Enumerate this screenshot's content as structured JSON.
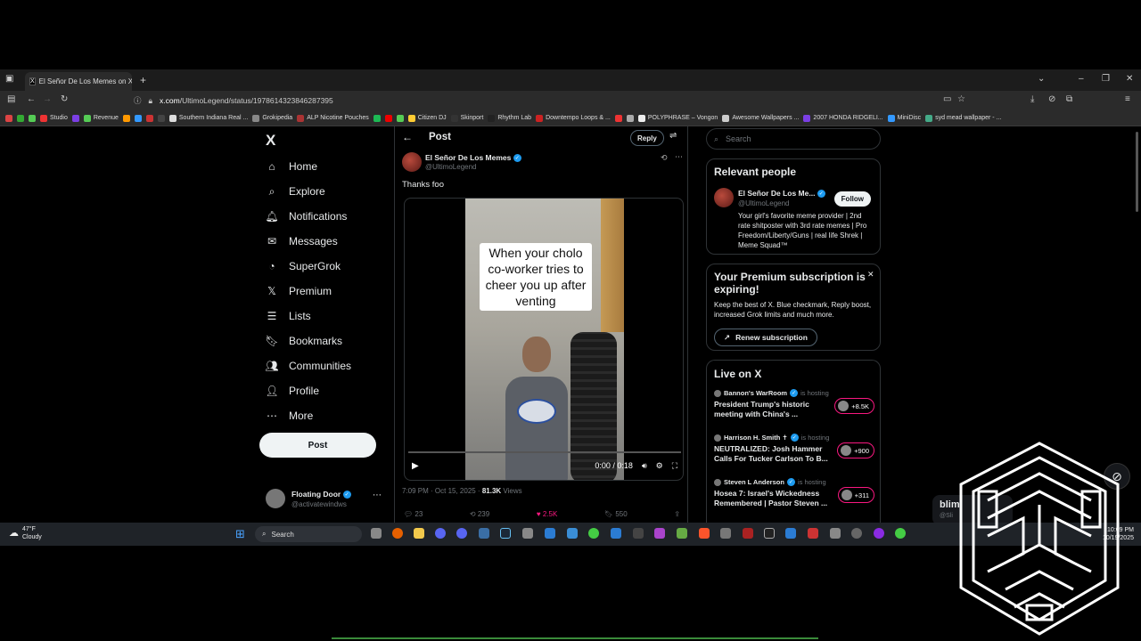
{
  "browser": {
    "tab_title": "El Señor De Los Memes on X: \"Thanks foo\"",
    "url_domain": "x.com",
    "url_path": "/UltimoLegend/status/1978614323846287395",
    "bookmarks": [
      "Studio",
      "Revenue",
      "Southern Indiana Real ...",
      "Grokipedia",
      "ALP Nicotine Pouches",
      "Citizen DJ",
      "Skinport",
      "Rhythm Lab",
      "Downtempo Loops & ...",
      "POLYPHRASE – Vongon",
      "Awesome Wallpapers ...",
      "2007 HONDA RIDGELI...",
      "MiniDisc",
      "syd mead wallpaper - ..."
    ]
  },
  "nav": {
    "logo": "X",
    "items": [
      {
        "label": "Home",
        "icon": "home-icon"
      },
      {
        "label": "Explore",
        "icon": "search-icon"
      },
      {
        "label": "Notifications",
        "icon": "bell-icon"
      },
      {
        "label": "Messages",
        "icon": "mail-icon"
      },
      {
        "label": "SuperGrok",
        "icon": "grok-icon"
      },
      {
        "label": "Premium",
        "icon": "x-premium-icon"
      },
      {
        "label": "Lists",
        "icon": "list-icon"
      },
      {
        "label": "Bookmarks",
        "icon": "bookmark-icon"
      },
      {
        "label": "Communities",
        "icon": "people-icon"
      },
      {
        "label": "Profile",
        "icon": "person-icon"
      },
      {
        "label": "More",
        "icon": "more-circle-icon"
      }
    ],
    "post_label": "Post",
    "account_name": "Floating Door",
    "account_handle": "@activatewindws"
  },
  "post": {
    "header": "Post",
    "reply_label": "Reply",
    "author_name": "El Señor De Los Memes",
    "author_handle": "@UltimoLegend",
    "text": "Thanks foo",
    "video_caption": "When your cholo co-worker tries to cheer you up after venting",
    "video_time": "0:00 / 0:18",
    "video_progress": 0,
    "timestamp": "7:09 PM · Oct 15, 2025 · ",
    "views_count": "81.3K",
    "views_label": " Views",
    "replies": "23",
    "reposts": "239",
    "likes": "2.5K",
    "bookmarks": "550"
  },
  "sidebar": {
    "search_placeholder": "Search",
    "relevant_title": "Relevant people",
    "person_name": "El Señor De Los Me...",
    "person_handle": "@UltimoLegend",
    "person_bio": "Your girl's favorite meme provider | 2nd rate shitposter with 3rd rate memes | Pro Freedom/Liberty/Guns | real life Shrek | Meme Squad™",
    "follow_label": "Follow",
    "premium_title": "Your Premium subscription is expiring!",
    "premium_text": "Keep the best of X. Blue checkmark, Reply boost, increased Grok limits and much more.",
    "renew_label": "Renew subscription",
    "live_title": "Live on X",
    "live": [
      {
        "host": "Bannon's WarRoom",
        "hosting": "is hosting",
        "title": "President Trump's historic meeting with China's ...",
        "count": "+8.5K"
      },
      {
        "host": "Harrison H. Smith ✝",
        "hosting": "is hosting",
        "title": "NEUTRALIZED: Josh Hammer Calls For Tucker Carlson To B...",
        "count": "+900"
      },
      {
        "host": "Steven L Anderson",
        "hosting": "is hosting",
        "title": "Hosea 7: Israel's Wickedness Remembered | Pastor Steven ...",
        "count": "+311"
      }
    ]
  },
  "taskbar": {
    "temp": "47°F",
    "condition": "Cloudy",
    "search_label": "Search",
    "time": "10:09 PM",
    "date": "10/19/2025"
  },
  "overlay": {
    "text": "blim",
    "sub": "@Sli"
  },
  "colors": {
    "accent": "#1d9bf0",
    "like": "#f91880",
    "background": "#000000"
  }
}
